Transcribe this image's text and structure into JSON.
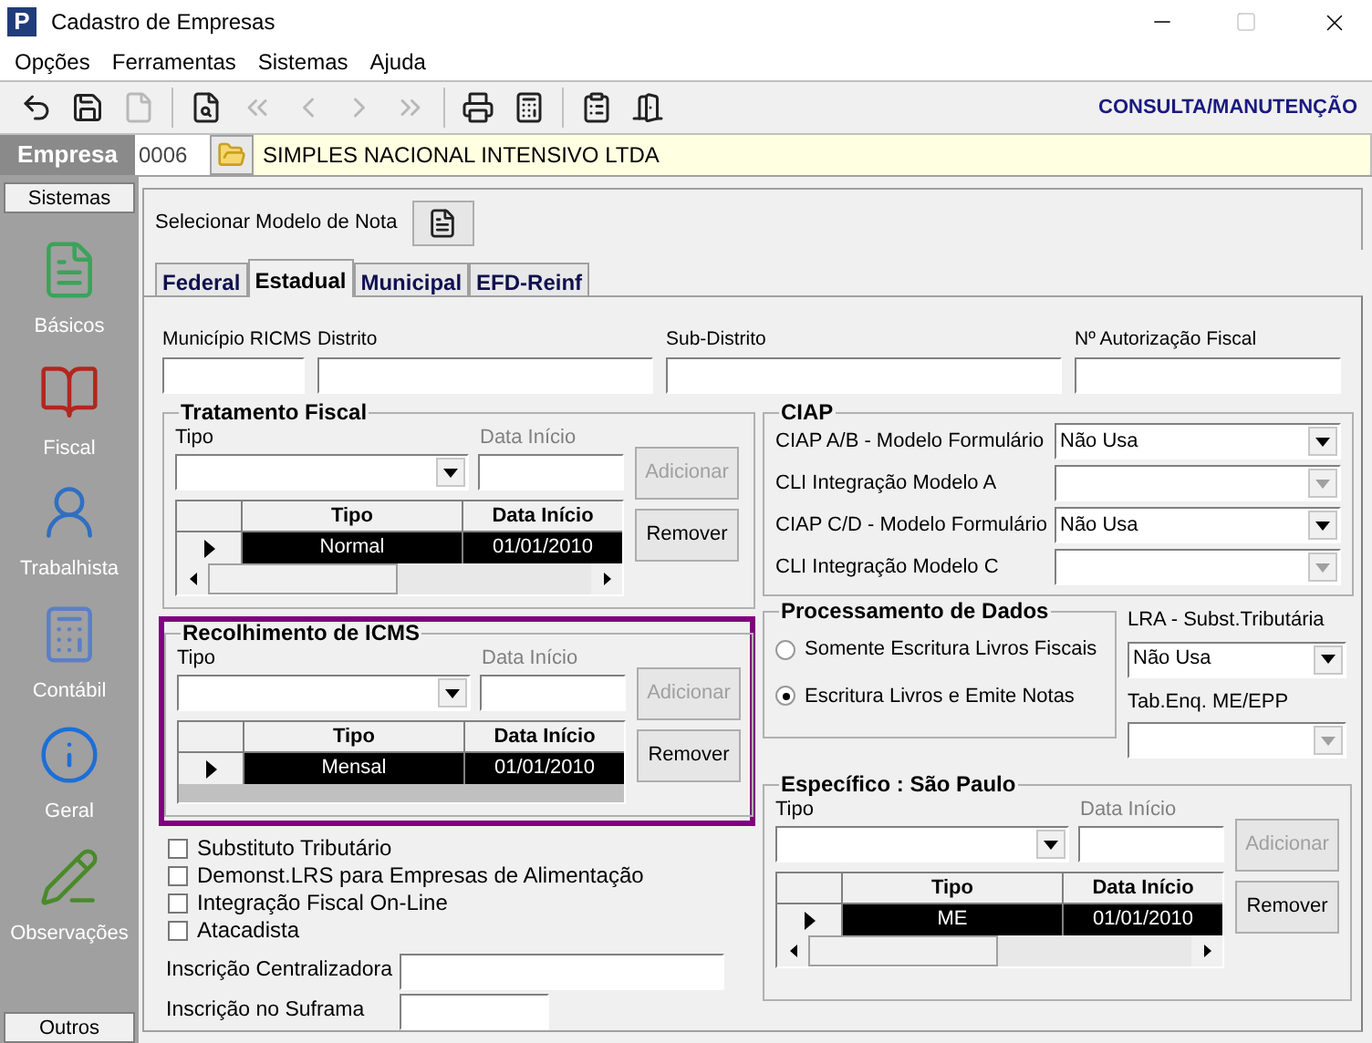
{
  "window": {
    "logo_letter": "P",
    "title": "Cadastro de Empresas"
  },
  "menu": [
    "Opções",
    "Ferramentas",
    "Sistemas",
    "Ajuda"
  ],
  "toolbar": [
    {
      "kind": "undo",
      "disabled": false
    },
    {
      "kind": "save",
      "disabled": false
    },
    {
      "kind": "document",
      "disabled": true
    },
    {
      "kind": "preview",
      "disabled": false
    },
    {
      "kind": "first",
      "disabled": true
    },
    {
      "kind": "previous",
      "disabled": true
    },
    {
      "kind": "next",
      "disabled": true
    },
    {
      "kind": "last",
      "disabled": true
    },
    {
      "kind": "print",
      "disabled": false
    },
    {
      "kind": "calculator",
      "disabled": false
    },
    {
      "kind": "report",
      "disabled": false
    },
    {
      "kind": "exit",
      "disabled": false
    }
  ],
  "mode_label": "CONSULTA/MANUTENÇÃO",
  "empresa": {
    "label": "Empresa",
    "code": "0006",
    "name": "SIMPLES NACIONAL INTENSIVO LTDA"
  },
  "sidebar": {
    "header": "Sistemas",
    "items": [
      {
        "kind": "basicos",
        "label": "Básicos"
      },
      {
        "kind": "fiscal",
        "label": "Fiscal"
      },
      {
        "kind": "trabalhista",
        "label": "Trabalhista"
      },
      {
        "kind": "contabil",
        "label": "Contábil"
      },
      {
        "kind": "geral",
        "label": "Geral"
      },
      {
        "kind": "observacoes",
        "label": "Observações"
      }
    ],
    "footer": "Outros"
  },
  "modelo_nota": {
    "label": "Selecionar Modelo de Nota"
  },
  "tabs": [
    {
      "label": "Federal",
      "selected": false
    },
    {
      "label": "Estadual",
      "selected": true
    },
    {
      "label": "Municipal",
      "selected": false
    },
    {
      "label": "EFD-Reinf",
      "selected": false
    }
  ],
  "fiscal_fields": [
    {
      "label": "Município RICMS"
    },
    {
      "label": "Distrito"
    },
    {
      "label": "Sub-Distrito"
    },
    {
      "label": "Nº Autorização Fiscal"
    }
  ],
  "tratamento_fiscal": {
    "title": "Tratamento Fiscal",
    "highlighted": false,
    "tipo_label": "Tipo",
    "data_label": "Data Início",
    "add_button": {
      "label": "Adicionar",
      "disabled": true
    },
    "remove_button": {
      "label": "Remover",
      "disabled": false
    },
    "columns": [
      "Tipo",
      "Data Início"
    ],
    "rows": [
      {
        "tipo": "Normal",
        "data": "01/01/2010",
        "selected": true
      }
    ],
    "horizontal_scrollbar": true
  },
  "recolhimento_icms": {
    "title": "Recolhimento de ICMS",
    "highlighted": true,
    "tipo_label": "Tipo",
    "data_label": "Data Início",
    "add_button": {
      "label": "Adicionar",
      "disabled": true
    },
    "remove_button": {
      "label": "Remover",
      "disabled": false
    },
    "columns": [
      "Tipo",
      "Data Início"
    ],
    "rows": [
      {
        "tipo": "Mensal",
        "data": "01/01/2010",
        "selected": true
      }
    ],
    "horizontal_scrollbar": false
  },
  "checkboxes": [
    {
      "label": "Substituto Tributário",
      "checked": false
    },
    {
      "label": "Demonst.LRS para Empresas de Alimentação",
      "checked": false
    },
    {
      "label": "Integração Fiscal On-Line",
      "checked": false
    },
    {
      "label": "Atacadista",
      "checked": false
    }
  ],
  "inscricoes": [
    {
      "label": "Inscrição Centralizadora",
      "wide": true
    },
    {
      "label": "Inscrição no Suframa",
      "wide": false
    }
  ],
  "ciap": {
    "title": "CIAP",
    "rows": [
      {
        "label": "CIAP  A/B - Modelo Formulário",
        "value": "Não Usa",
        "disabled": false
      },
      {
        "label": "CLI Integração Modelo A",
        "disabled": true
      },
      {
        "label": "CIAP C/D - Modelo Formulário",
        "value": "Não Usa",
        "disabled": false
      },
      {
        "label": "CLI Integração Modelo C",
        "disabled": true
      }
    ]
  },
  "processamento": {
    "title": "Processamento de Dados",
    "options": [
      {
        "label": "Somente Escritura Livros Fiscais",
        "selected": false
      },
      {
        "label": "Escritura Livros e Emite Notas",
        "selected": true
      }
    ]
  },
  "lra": {
    "label": "LRA - Subst.Tributária",
    "value": "Não Usa",
    "disabled": false
  },
  "tab_enq": {
    "label": "Tab.Enq. ME/EPP",
    "disabled": true
  },
  "especifico": {
    "title": "Específico : São Paulo",
    "highlighted": false,
    "tipo_label": "Tipo",
    "data_label": "Data Início",
    "add_button": {
      "label": "Adicionar",
      "disabled": true
    },
    "remove_button": {
      "label": "Remover",
      "disabled": false
    },
    "columns": [
      "Tipo",
      "Data Início"
    ],
    "rows": [
      {
        "tipo": "ME",
        "data": "01/01/2010",
        "selected": true
      }
    ],
    "horizontal_scrollbar": true
  }
}
